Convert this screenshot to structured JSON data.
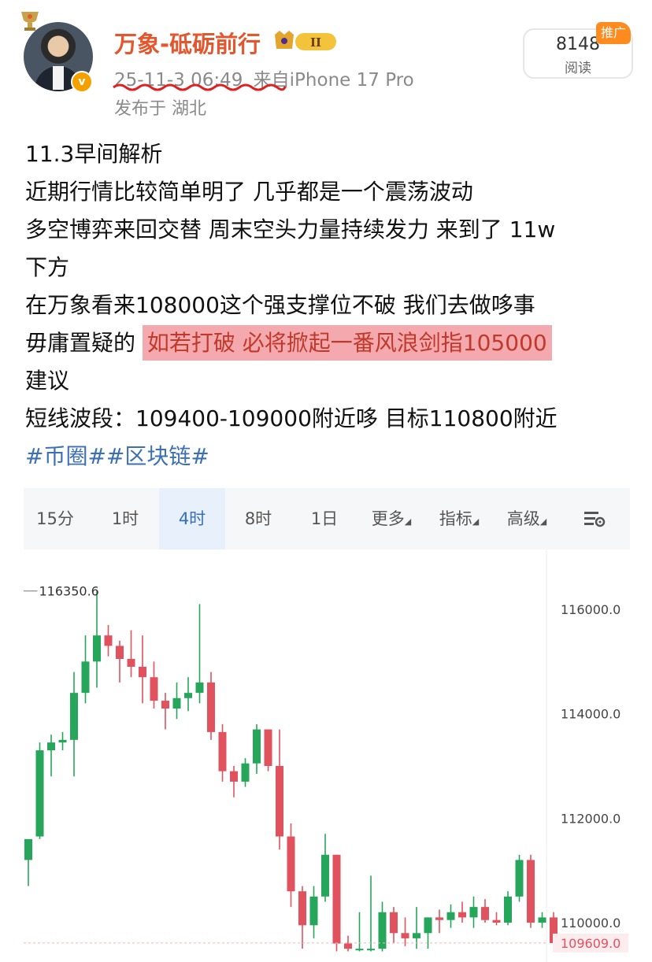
{
  "post_header": {
    "username": "万象-砥砺前行",
    "level_badge": "II",
    "timestamp": "25-11-3 06:49",
    "source": "来自iPhone 17 Pro",
    "location": "发布于 湖北",
    "read_count": "8148",
    "read_label": "阅读",
    "promo_tag": "推广",
    "verified_mark": "v"
  },
  "post_body": {
    "line1": "11.3早间解析",
    "line2": "近期行情比较简单明了 几乎都是一个震荡波动",
    "line3": "多空博弈来回交替 周末空头力量持续发力 来到了 11w",
    "line4": "下方",
    "line5": "在万象看来108000这个强支撑位不破 我们去做哆事",
    "line6_plain": "毋庸置疑的 ",
    "line6_highlight": "如若打破 必将掀起一番风浪剑指105000",
    "line7": "建议",
    "line8": "短线波段：109400-109000附近哆 目标110800附近",
    "tags": "#币圈##区块链#"
  },
  "kline_tabs": {
    "t15m": "15分",
    "t1h": "1时",
    "t4h": "4时",
    "t8h": "8时",
    "t1d": "1日",
    "more": "更多",
    "indicators": "指标",
    "advanced": "高级",
    "settings_icon": "settings-list-icon"
  },
  "colors": {
    "up": "#26a65b",
    "down": "#e0525e",
    "username": "#e4572e",
    "tag": "#3b6fb6",
    "highlight_bg": "#f3a9ad"
  },
  "chart_data": {
    "type": "candlestick",
    "y_ticks": [
      "116000.0",
      "114000.0",
      "112000.0",
      "110000.0"
    ],
    "ylim": [
      109450,
      116700
    ],
    "high_label": "116350.6",
    "current_price": "109609.0",
    "candles": [
      {
        "o": 111200,
        "h": 111300,
        "l": 110700,
        "c": 111600
      },
      {
        "o": 111650,
        "h": 113450,
        "l": 111600,
        "c": 113300
      },
      {
        "o": 113300,
        "h": 113600,
        "l": 112800,
        "c": 113450
      },
      {
        "o": 113450,
        "h": 113650,
        "l": 113300,
        "c": 113500
      },
      {
        "o": 113500,
        "h": 114800,
        "l": 112800,
        "c": 114400
      },
      {
        "o": 114400,
        "h": 115500,
        "l": 114200,
        "c": 115000
      },
      {
        "o": 115000,
        "h": 116350,
        "l": 114500,
        "c": 115500
      },
      {
        "o": 115500,
        "h": 115700,
        "l": 115100,
        "c": 115300
      },
      {
        "o": 115300,
        "h": 115400,
        "l": 114600,
        "c": 115050
      },
      {
        "o": 115050,
        "h": 115600,
        "l": 114700,
        "c": 114900
      },
      {
        "o": 114900,
        "h": 115500,
        "l": 114200,
        "c": 114700
      },
      {
        "o": 114700,
        "h": 115000,
        "l": 114100,
        "c": 114250
      },
      {
        "o": 114250,
        "h": 114400,
        "l": 113700,
        "c": 114100
      },
      {
        "o": 114100,
        "h": 114600,
        "l": 113900,
        "c": 114300
      },
      {
        "o": 114300,
        "h": 114700,
        "l": 114050,
        "c": 114400
      },
      {
        "o": 114400,
        "h": 116100,
        "l": 114200,
        "c": 114600
      },
      {
        "o": 114600,
        "h": 114800,
        "l": 113500,
        "c": 113650
      },
      {
        "o": 113650,
        "h": 113800,
        "l": 112700,
        "c": 112900
      },
      {
        "o": 112900,
        "h": 113000,
        "l": 112400,
        "c": 112700
      },
      {
        "o": 112700,
        "h": 113150,
        "l": 112600,
        "c": 113050
      },
      {
        "o": 113050,
        "h": 113800,
        "l": 112850,
        "c": 113700
      },
      {
        "o": 113700,
        "h": 113700,
        "l": 112900,
        "c": 113000
      },
      {
        "o": 113000,
        "h": 113700,
        "l": 111400,
        "c": 111650
      },
      {
        "o": 111650,
        "h": 111900,
        "l": 110300,
        "c": 110600
      },
      {
        "o": 110600,
        "h": 110700,
        "l": 109500,
        "c": 109950
      },
      {
        "o": 109950,
        "h": 110700,
        "l": 109700,
        "c": 110500
      },
      {
        "o": 110500,
        "h": 111700,
        "l": 110400,
        "c": 111300
      },
      {
        "o": 111300,
        "h": 111300,
        "l": 109450,
        "c": 109600
      },
      {
        "o": 109600,
        "h": 109750,
        "l": 109450,
        "c": 109500
      },
      {
        "o": 109500,
        "h": 110200,
        "l": 109450,
        "c": 109500
      },
      {
        "o": 109500,
        "h": 110900,
        "l": 109450,
        "c": 109500
      },
      {
        "o": 109500,
        "h": 110400,
        "l": 109450,
        "c": 110200
      },
      {
        "o": 110200,
        "h": 110300,
        "l": 109600,
        "c": 109800
      },
      {
        "o": 109800,
        "h": 110100,
        "l": 109550,
        "c": 109700
      },
      {
        "o": 109700,
        "h": 110300,
        "l": 109500,
        "c": 109800
      },
      {
        "o": 109800,
        "h": 110100,
        "l": 109500,
        "c": 110100
      },
      {
        "o": 110100,
        "h": 110250,
        "l": 109800,
        "c": 110050
      },
      {
        "o": 110050,
        "h": 110350,
        "l": 109900,
        "c": 110200
      },
      {
        "o": 110200,
        "h": 110400,
        "l": 110000,
        "c": 110100
      },
      {
        "o": 110100,
        "h": 110500,
        "l": 109900,
        "c": 110300
      },
      {
        "o": 110300,
        "h": 110450,
        "l": 110000,
        "c": 110050
      },
      {
        "o": 110050,
        "h": 110200,
        "l": 109950,
        "c": 110000
      },
      {
        "o": 110000,
        "h": 110600,
        "l": 109950,
        "c": 110500
      },
      {
        "o": 110500,
        "h": 111300,
        "l": 110400,
        "c": 111200
      },
      {
        "o": 111200,
        "h": 111300,
        "l": 109900,
        "c": 110000
      },
      {
        "o": 110000,
        "h": 110200,
        "l": 109900,
        "c": 110100
      },
      {
        "o": 110100,
        "h": 110200,
        "l": 109609,
        "c": 109609
      }
    ]
  }
}
